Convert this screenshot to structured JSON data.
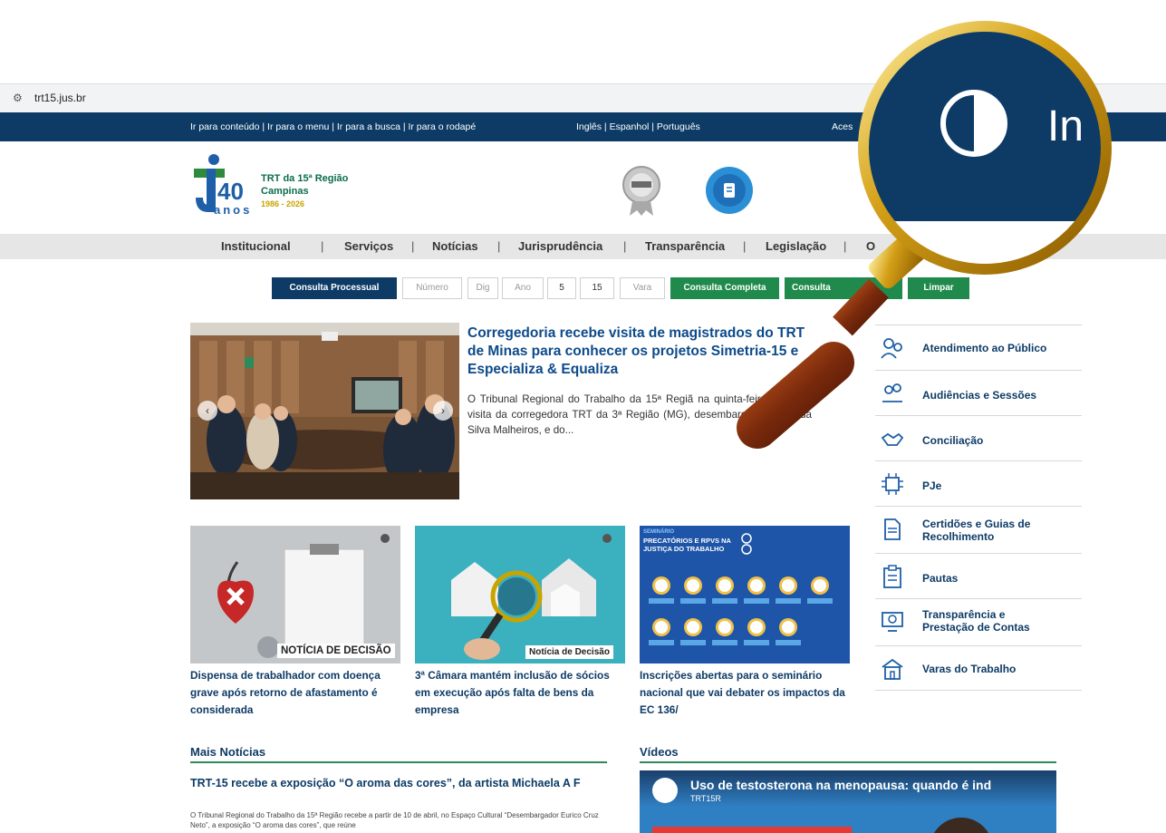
{
  "browser": {
    "url": "trt15.jus.br"
  },
  "topbar": {
    "skip_links": "Ir para conteúdo | Ir para o menu | Ir para a busca | Ir para o rodapé",
    "languages": "Inglês | Espanhol | Português",
    "access_label": "Aces"
  },
  "logo": {
    "line1": "TRT da 15ª Região",
    "line2": "Campinas",
    "years": "40",
    "anos": "anos",
    "dates": "1986 - 2026"
  },
  "nav": {
    "items": [
      "Institucional",
      "Serviços",
      "Notícias",
      "Jurisprudência",
      "Transparência",
      "Legislação",
      "O"
    ]
  },
  "consulta": {
    "button": "Consulta Processual",
    "numero_placeholder": "Número",
    "dig_placeholder": "Dig",
    "ano_placeholder": "Ano",
    "segment": "5",
    "tribunal": "15",
    "vara_placeholder": "Vara",
    "completa": "Consulta Completa",
    "consulta2": "Consulta",
    "limpar": "Limpar"
  },
  "featured": {
    "title": "Corregedoria recebe visita de magistrados do TRT de Minas para conhecer os projetos Simetria-15 e Especializa & Equaliza",
    "body": "O Tribunal Regional do Trabalho da 15ª Regiã na quinta-feira (26/3), a visita da corregedora TRT da 3ª Região (MG), desembargadora Mar da Silva Malheiros, e do..."
  },
  "sidebar": {
    "items": [
      {
        "label": "Atendimento ao Público",
        "icon": "people-icon"
      },
      {
        "label": "Audiências e Sessões",
        "icon": "meeting-icon"
      },
      {
        "label": "Conciliação",
        "icon": "handshake-icon"
      },
      {
        "label": "PJe",
        "icon": "chip-icon"
      },
      {
        "label": "Certidões e Guias de Recolhimento",
        "icon": "document-icon"
      },
      {
        "label": "Pautas",
        "icon": "clipboard-icon"
      },
      {
        "label": "Transparência e Prestação de Contas",
        "icon": "monitor-icon"
      },
      {
        "label": "Varas do Trabalho",
        "icon": "building-icon"
      }
    ]
  },
  "cards": [
    {
      "badge": "NOTÍCIA DE DECISÃO",
      "caption": "Dispensa de trabalhador com doença grave após retorno de afastamento é considerada"
    },
    {
      "badge": "Notícia de Decisão",
      "caption": "3ª Câmara mantém inclusão de sócios em execução após falta de bens da empresa"
    },
    {
      "poster_title": "PRECATÓRIOS E RPVS NA JUSTIÇA DO TRABALHO",
      "poster_kicker": "SEMINÁRIO",
      "caption": "Inscrições abertas para o seminário nacional que vai debater os impactos da EC 136/"
    }
  ],
  "mais_noticias": {
    "heading": "Mais Notícias",
    "title": "TRT-15 recebe a exposição “O aroma das cores”, da artista Michaela A F",
    "body": "O Tribunal Regional do Trabalho da 15ª Região recebe a partir de 10 de abril, no Espaço Cultural “Desembargador Eurico Cruz Neto”, a exposição “O aroma das cores”, que reúne"
  },
  "videos": {
    "heading": "Vídeos",
    "title": "Uso de testosterona na menopausa: quando é ind",
    "channel": "TRT15R"
  },
  "magnifier": {
    "zoomed_text": "In"
  },
  "colors": {
    "navy": "#0d3b66",
    "green": "#1f8a4c",
    "gold": "#d4a017"
  }
}
